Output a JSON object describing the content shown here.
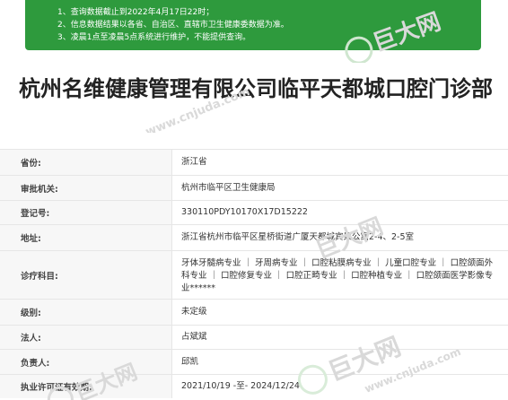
{
  "notice": {
    "lines": [
      "1、查询数据截止到2022年4月17日22时；",
      "2、信息数据结果以各省、自治区、直辖市卫生健康委数据为准。",
      "3、凌晨1点至凌晨5点系统进行维护，不能提供查询。"
    ]
  },
  "title": "杭州名维健康管理有限公司临平天都城口腔门诊部",
  "watermark": {
    "brand": "巨大网",
    "url": "www.cnjuda.com"
  },
  "rows": [
    {
      "label": "省份:",
      "value": "浙江省"
    },
    {
      "label": "审批机关:",
      "value": "杭州市临平区卫生健康局"
    },
    {
      "label": "登记号:",
      "value": "330110PDY10170X17D15222"
    },
    {
      "label": "地址:",
      "value": "浙江省杭州市临平区星桥街道广厦天都城宾果公寓2-4、2-5室"
    },
    {
      "label": "诊疗科目:",
      "value": "牙体牙髓病专业 ｜ 牙周病专业 ｜ 口腔粘膜病专业 ｜ 儿童口腔专业 ｜ 口腔颌面外科专业 ｜ 口腔修复专业 ｜ 口腔正畸专业 ｜ 口腔种植专业 ｜ 口腔颌面医学影像专业******"
    },
    {
      "label": "级别:",
      "value": "未定级"
    },
    {
      "label": "法人:",
      "value": "占斌斌"
    },
    {
      "label": "负责人:",
      "value": "邱凯"
    },
    {
      "label": "执业许可证有效期:",
      "value": "2021/10/19 -至- 2024/12/24"
    }
  ]
}
